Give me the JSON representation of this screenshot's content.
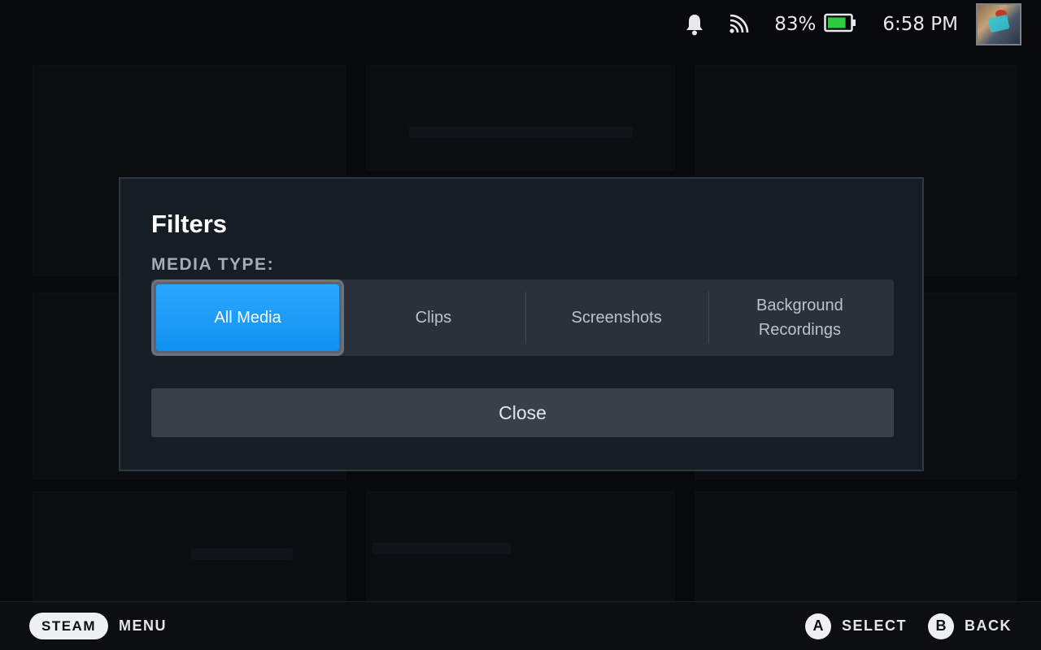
{
  "status": {
    "battery_percent": "83%",
    "battery_level": 0.83,
    "time": "6:58 PM",
    "icons": [
      "bell-icon",
      "wifi-signal-icon",
      "battery-icon"
    ]
  },
  "modal": {
    "title": "Filters",
    "section_label": "MEDIA TYPE:",
    "options": [
      {
        "label": "All Media",
        "selected": true
      },
      {
        "label": "Clips",
        "selected": false
      },
      {
        "label": "Screenshots",
        "selected": false
      },
      {
        "label": "Background\nRecordings",
        "selected": false
      }
    ],
    "close_label": "Close"
  },
  "footer": {
    "steam_label": "STEAM",
    "menu_label": "MENU",
    "a_glyph": "A",
    "select_label": "SELECT",
    "b_glyph": "B",
    "back_label": "BACK"
  },
  "colors": {
    "accent": "#1a9fff",
    "modal_bg": "#161d25",
    "segment_bg": "#2a313a",
    "battery_green": "#2ecc40"
  }
}
